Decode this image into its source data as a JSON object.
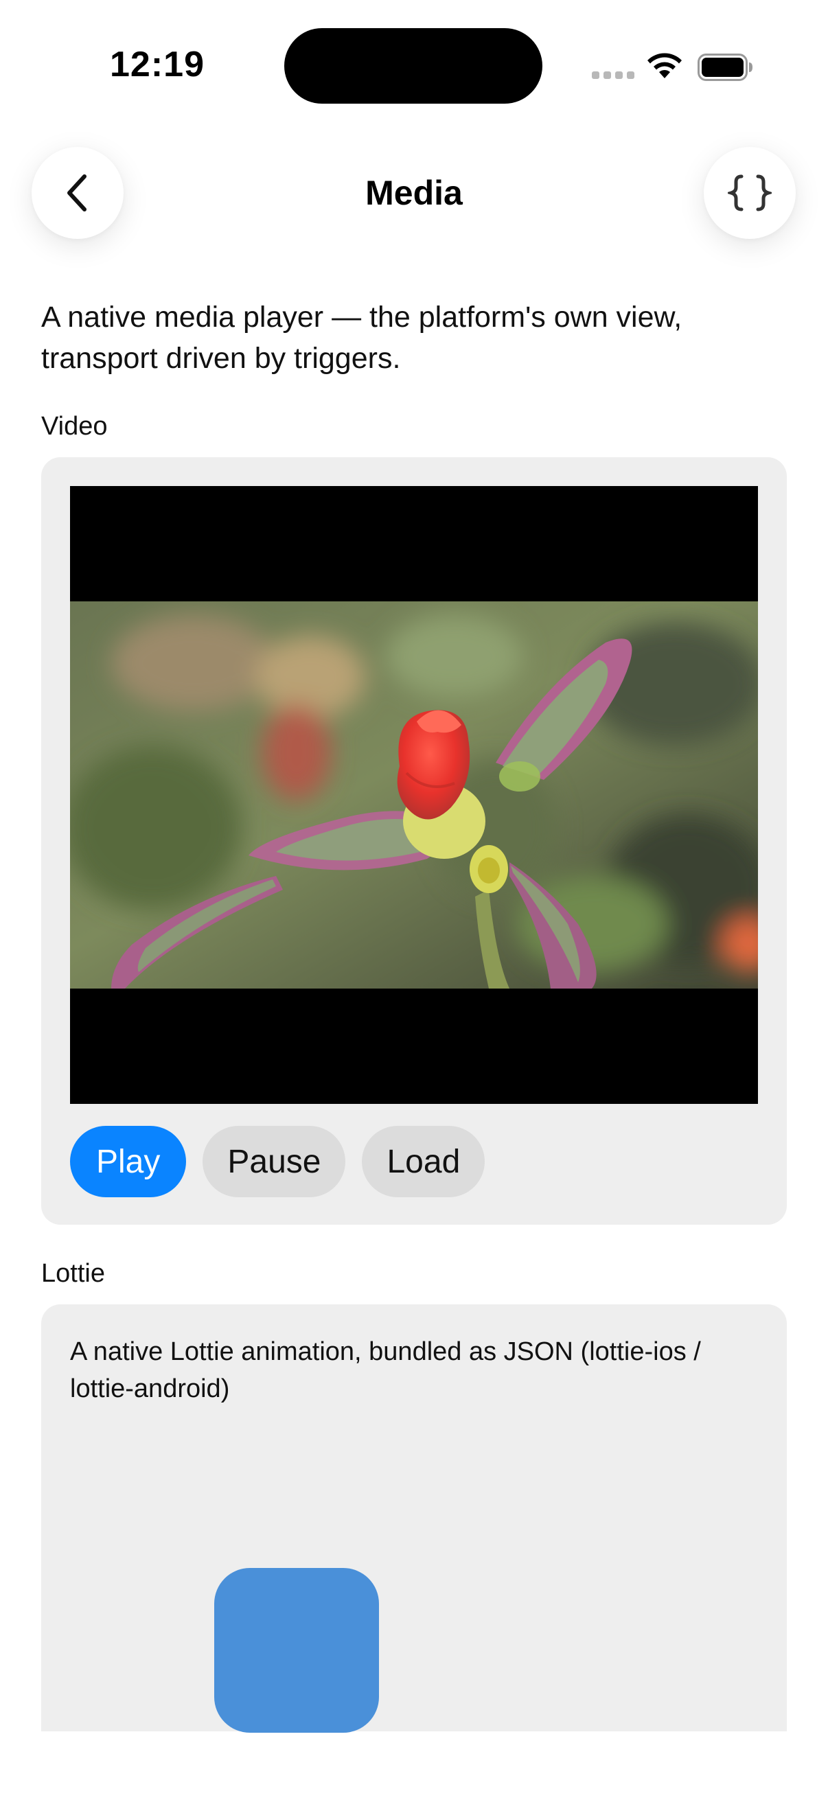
{
  "status_bar": {
    "time": "12:19"
  },
  "nav": {
    "title": "Media",
    "back_icon": "chevron-left-icon",
    "code_icon": "curly-braces-icon"
  },
  "intro": "A native media player — the platform's own view, transport driven by triggers.",
  "video_section": {
    "label": "Video",
    "buttons": {
      "play": "Play",
      "pause": "Pause",
      "load": "Load"
    },
    "colors": {
      "primary": "#0a84ff",
      "secondary": "#dcdcdc",
      "card": "#eeeeee"
    }
  },
  "lottie_section": {
    "label": "Lottie",
    "description": "A native Lottie animation, bundled as JSON (lottie-ios / lottie-android)",
    "shape_color": "#4a90d9"
  }
}
